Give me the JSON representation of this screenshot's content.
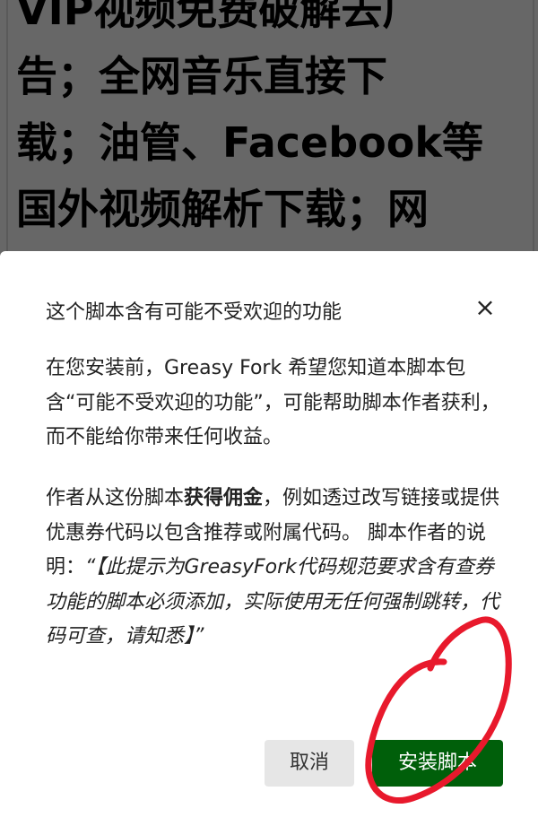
{
  "background_page": {
    "lines": [
      "VIP视频免费破解去广",
      "告；全网音乐直接下",
      "载；油管、Facebook等",
      "国外视频解析下载；网"
    ]
  },
  "dialog": {
    "title": "这个脚本含有可能不受欢迎的功能",
    "close_icon": "close-icon",
    "paragraph1": "在您安装前，Greasy Fork 希望您知道本脚本包含“可能不受欢迎的功能”，可能帮助脚本作者获利，而不能给你带来任何收益。",
    "paragraph2_prefix": "作者从这份脚本",
    "paragraph2_bold": "获得佣金",
    "paragraph2_suffix": "，例如透过改写链接或提供优惠券代码以包含推荐或附属代码。 脚本作者的说明：",
    "author_note": "“【此提示为GreasyFork代码规范要求含有查券功能的脚本必须添加，实际使用无任何强制跳转，代码可查，请知悉】”",
    "cancel_label": "取消",
    "install_label": "安装脚本"
  },
  "colors": {
    "install": "#005f0a",
    "annotation": "#e8192c"
  }
}
